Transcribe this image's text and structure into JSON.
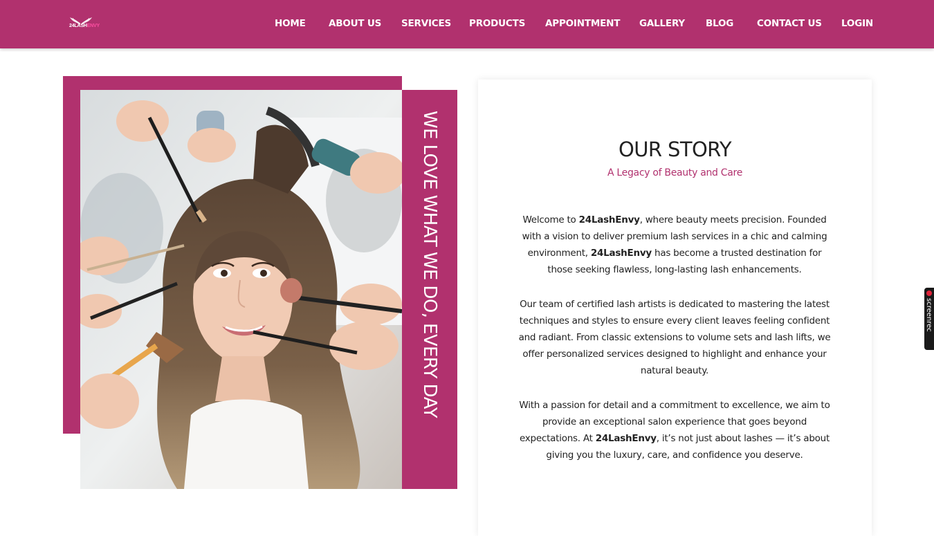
{
  "header": {
    "logo_text_primary": "24LASH",
    "logo_text_accent": "ENVY",
    "nav": [
      {
        "label": "HOME"
      },
      {
        "label": "ABOUT US"
      },
      {
        "label": "SERVICES"
      },
      {
        "label": "PRODUCTS"
      },
      {
        "label": "APPOINTMENT"
      },
      {
        "label": "GALLERY"
      },
      {
        "label": "BLOG"
      },
      {
        "label": "CONTACT US"
      },
      {
        "label": "LOGIN"
      }
    ]
  },
  "hero": {
    "vertical_text": "WE LOVE WHAT WE DO, EVERY DAY"
  },
  "story": {
    "title": "OUR STORY",
    "subtitle": "A Legacy of Beauty and Care",
    "brand": "24LashEnvy",
    "p1": {
      "a": "Welcome to ",
      "b": ", where beauty meets precision. Founded with a vision to deliver premium lash services in a chic and calming environment, ",
      "c": " has become a trusted destination for those seeking flawless, long-lasting lash enhancements."
    },
    "p2": "Our team of certified lash artists is dedicated to mastering the latest techniques and styles to ensure every client leaves feeling confident and radiant. From classic extensions to volume sets and lash lifts, we offer personalized services designed to highlight and enhance your natural beauty.",
    "p3": {
      "a": "With a passion for detail and a commitment to excellence, we aim to provide an exceptional salon experience that goes beyond expectations. At ",
      "b": ", it’s not just about lashes — it’s about giving you the luxury, care, and confidence you deserve."
    }
  },
  "overlay": {
    "label": "screenrec"
  },
  "colors": {
    "brand": "#b1316e",
    "text": "#222222",
    "background": "#ffffff"
  }
}
